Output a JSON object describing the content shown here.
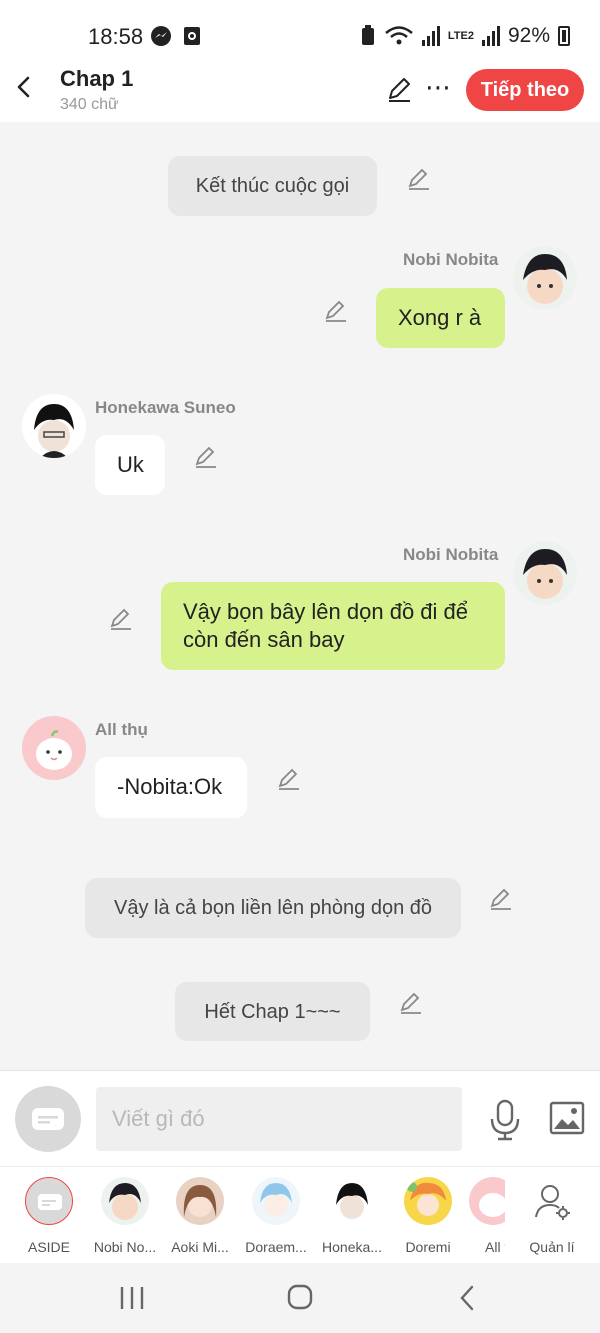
{
  "status": {
    "time": "18:58",
    "network": "LTE2",
    "battery": "92%"
  },
  "header": {
    "title": "Chap 1",
    "subtitle": "340 chữ",
    "next_label": "Tiếp theo"
  },
  "messages": [
    {
      "type": "narration",
      "text": "Kết thúc cuộc gọi"
    },
    {
      "type": "me",
      "name": "Nobi Nobita",
      "text": "Xong r à"
    },
    {
      "type": "other",
      "name": "Honekawa Suneo",
      "text": "Uk"
    },
    {
      "type": "me",
      "name": "Nobi Nobita",
      "text": "Vậy bọn bây lên dọn đồ đi để còn đến sân bay"
    },
    {
      "type": "other",
      "name": "All thụ",
      "text": "-Nobita:Ok"
    },
    {
      "type": "narration",
      "text": "Vậy là cả bọn liền lên phòng dọn đồ"
    },
    {
      "type": "narration",
      "text": "Hết Chap 1~~~"
    }
  ],
  "input": {
    "placeholder": "Viết gì đó"
  },
  "characters": [
    {
      "label": "ASIDE"
    },
    {
      "label": "Nobi No..."
    },
    {
      "label": "Aoki Mi..."
    },
    {
      "label": "Doraem..."
    },
    {
      "label": "Honeka..."
    },
    {
      "label": "Doremi"
    },
    {
      "label": "All t"
    },
    {
      "label": "Quản lí"
    }
  ],
  "colors": {
    "accent": "#f04545",
    "me_bubble": "#d7f28c",
    "narration_bubble": "#e7e7e7"
  }
}
